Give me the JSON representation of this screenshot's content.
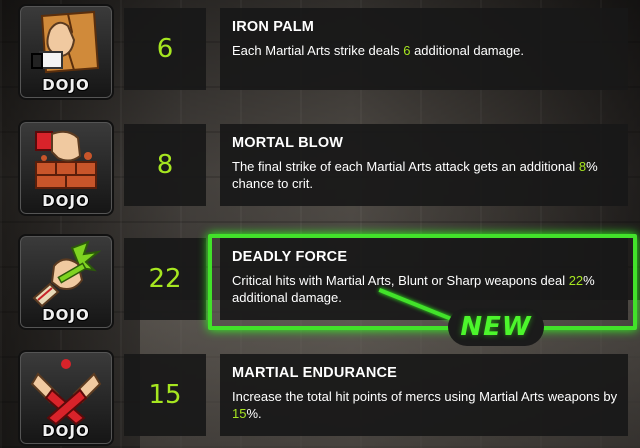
{
  "perks": [
    {
      "title": "IRON PALM",
      "value": "6",
      "icon": "palm-breaking-board-icon",
      "badge": "DOJO",
      "desc_pre": "Each Martial Arts strike deals ",
      "desc_hl": "6",
      "desc_post": " additional damage."
    },
    {
      "title": "MORTAL BLOW",
      "value": "8",
      "icon": "fist-breaking-bricks-icon",
      "badge": "DOJO",
      "desc_pre": "The final strike of each Martial Arts attack gets an additional ",
      "desc_hl": "8",
      "desc_post": "% chance to crit."
    },
    {
      "title": "DEADLY FORCE",
      "value": "22",
      "icon": "fist-crushing-plant-icon",
      "badge": "DOJO",
      "desc_pre": "Critical hits with Martial Arts, Blunt or Sharp weapons deal ",
      "desc_hl": "22",
      "desc_post": "% additional damage.",
      "selected": true
    },
    {
      "title": "MARTIAL ENDURANCE",
      "value": "15",
      "icon": "crossed-wrapped-fists-icon",
      "badge": "DOJO",
      "desc_pre": "Increase the total hit points of mercs using Martial Arts weapons by ",
      "desc_hl": "15",
      "desc_post": "%."
    }
  ],
  "new_badge": "NEW",
  "colors": {
    "highlight": "#a6e620",
    "selection": "#42e22a",
    "panel": "#181818"
  }
}
